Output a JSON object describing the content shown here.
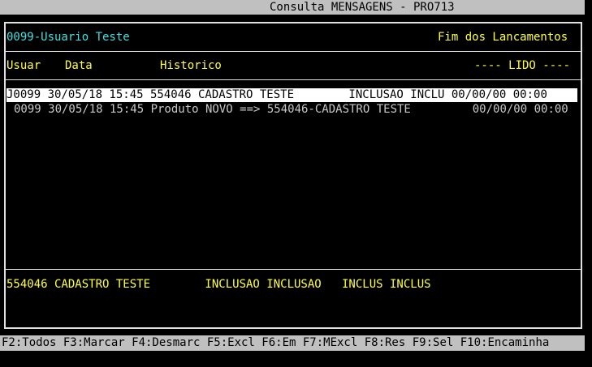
{
  "window": {
    "title": "Consulta MENSAGENS - PRO713"
  },
  "header": {
    "user_label": "0099-Usuario Teste",
    "status_label": "Fim dos Lancamentos"
  },
  "columns": {
    "usuar": "Usuar",
    "data": "Data",
    "historico": "Historico",
    "lido": "---- LIDO ----"
  },
  "rows": [
    {
      "text": "J0099 30/05/18 15:45 554046 CADASTRO TESTE        INCLUSAO INCLU 00/00/00 00:00",
      "selected": true
    },
    {
      "text": "0099 30/05/18 15:45 Produto NOVO ==> 554046-CADASTRO TESTE         00/00/00 00:00",
      "selected": false
    }
  ],
  "detail": {
    "text": "554046 CADASTRO TESTE        INCLUSAO INCLUSAO   INCLUS INCLUS"
  },
  "function_keys": {
    "text": "F2:Todos F3:Marcar F4:Desmarc F5:Excl F6:Em F7:MExcl F8:Res F9:Sel F10:Encaminha"
  }
}
